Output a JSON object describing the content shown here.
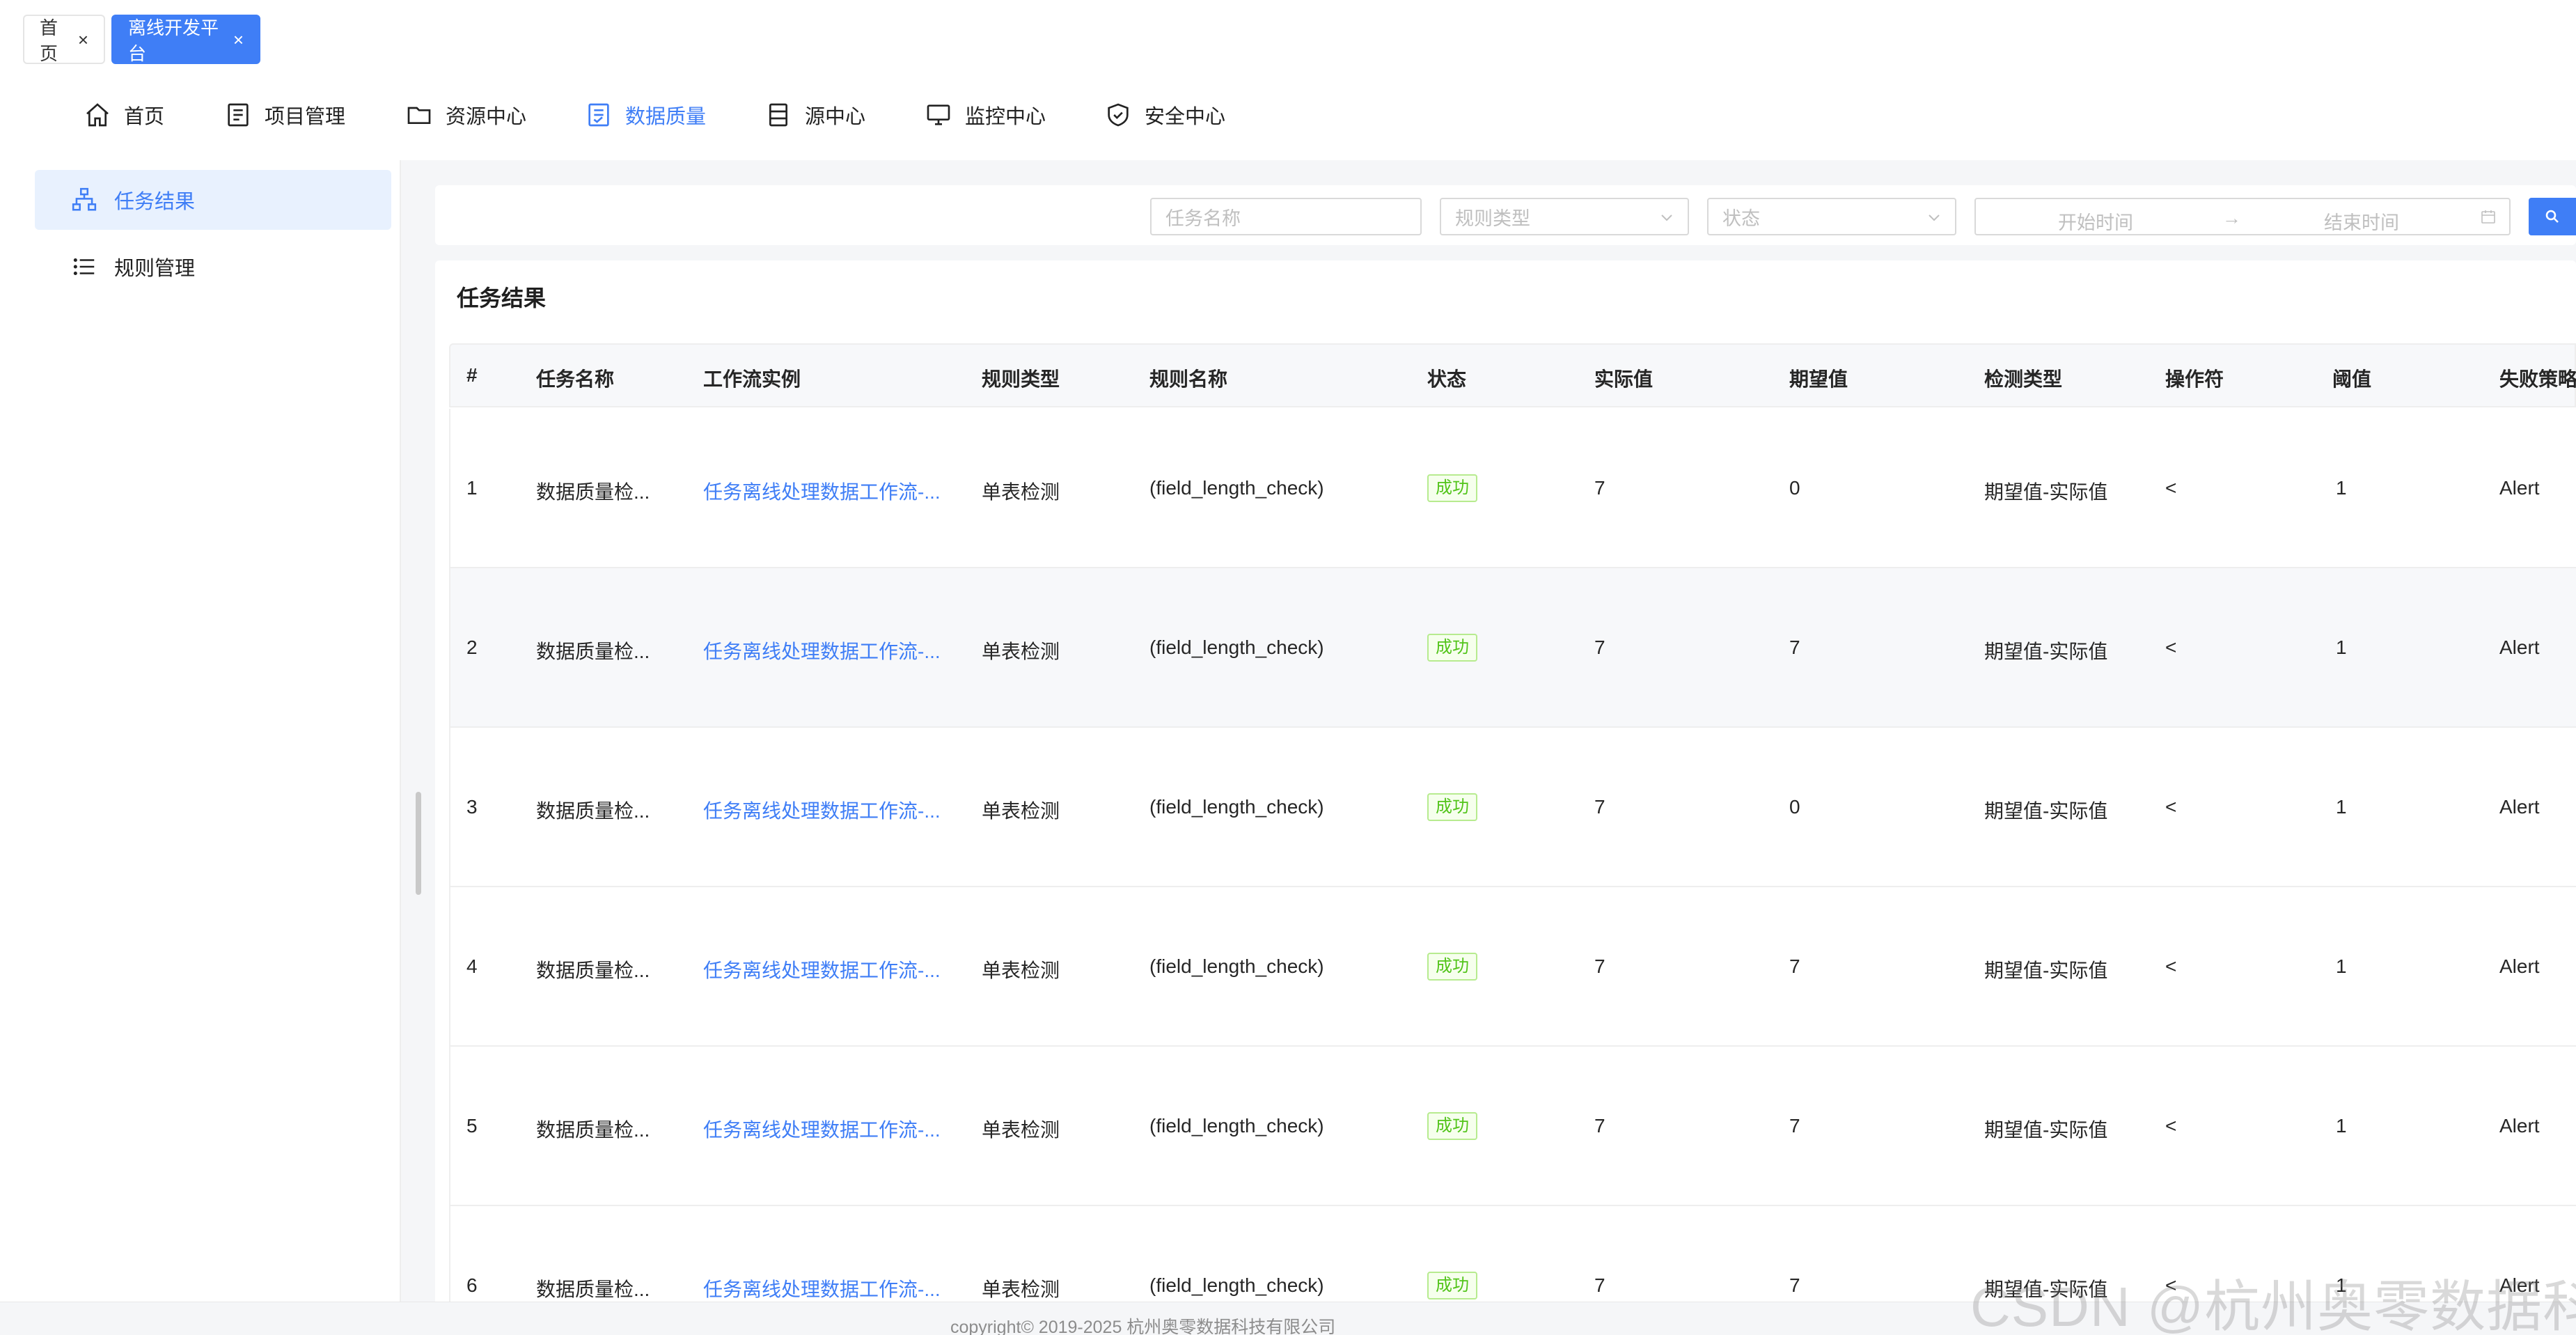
{
  "tabs": [
    {
      "label": "首页"
    },
    {
      "label": "离线开发平台"
    }
  ],
  "topnav": [
    {
      "label": "首页",
      "icon": "home-icon"
    },
    {
      "label": "项目管理",
      "icon": "project-icon"
    },
    {
      "label": "资源中心",
      "icon": "folder-icon"
    },
    {
      "label": "数据质量",
      "icon": "data-quality-icon",
      "active": true
    },
    {
      "label": "源中心",
      "icon": "datasource-icon"
    },
    {
      "label": "监控中心",
      "icon": "monitor-icon"
    },
    {
      "label": "安全中心",
      "icon": "shield-icon"
    }
  ],
  "sidebar": [
    {
      "label": "任务结果",
      "icon": "org-chart-icon",
      "active": true
    },
    {
      "label": "规则管理",
      "icon": "list-icon"
    }
  ],
  "filters": {
    "task_name_placeholder": "任务名称",
    "rule_type_placeholder": "规则类型",
    "status_placeholder": "状态",
    "start_time_placeholder": "开始时间",
    "end_time_placeholder": "结束时间",
    "range_separator": "→"
  },
  "card": {
    "title": "任务结果"
  },
  "table": {
    "columns": [
      "#",
      "任务名称",
      "工作流实例",
      "规则类型",
      "规则名称",
      "状态",
      "实际值",
      "期望值",
      "检测类型",
      "操作符",
      "阈值",
      "失败策略"
    ],
    "rows": [
      {
        "no": "1",
        "task_name": "数据质量检...",
        "workflow": "任务离线处理数据工作流-...",
        "rule_type": "单表检测",
        "rule_name": "(field_length_check)",
        "status": "成功",
        "actual": "7",
        "expected": "0",
        "check_type": "期望值-实际值",
        "operator": "<",
        "threshold": "1",
        "fail_strategy": "Alert"
      },
      {
        "no": "2",
        "task_name": "数据质量检...",
        "workflow": "任务离线处理数据工作流-...",
        "rule_type": "单表检测",
        "rule_name": "(field_length_check)",
        "status": "成功",
        "actual": "7",
        "expected": "7",
        "check_type": "期望值-实际值",
        "operator": "<",
        "threshold": "1",
        "fail_strategy": "Alert"
      },
      {
        "no": "3",
        "task_name": "数据质量检...",
        "workflow": "任务离线处理数据工作流-...",
        "rule_type": "单表检测",
        "rule_name": "(field_length_check)",
        "status": "成功",
        "actual": "7",
        "expected": "0",
        "check_type": "期望值-实际值",
        "operator": "<",
        "threshold": "1",
        "fail_strategy": "Alert"
      },
      {
        "no": "4",
        "task_name": "数据质量检...",
        "workflow": "任务离线处理数据工作流-...",
        "rule_type": "单表检测",
        "rule_name": "(field_length_check)",
        "status": "成功",
        "actual": "7",
        "expected": "7",
        "check_type": "期望值-实际值",
        "operator": "<",
        "threshold": "1",
        "fail_strategy": "Alert"
      },
      {
        "no": "5",
        "task_name": "数据质量检...",
        "workflow": "任务离线处理数据工作流-...",
        "rule_type": "单表检测",
        "rule_name": "(field_length_check)",
        "status": "成功",
        "actual": "7",
        "expected": "7",
        "check_type": "期望值-实际值",
        "operator": "<",
        "threshold": "1",
        "fail_strategy": "Alert"
      },
      {
        "no": "6",
        "task_name": "数据质量检...",
        "workflow": "任务离线处理数据工作流-...",
        "rule_type": "单表检测",
        "rule_name": "(field_length_check)",
        "status": "成功",
        "actual": "7",
        "expected": "7",
        "check_type": "期望值-实际值",
        "operator": "<",
        "threshold": "1",
        "fail_strategy": "Alert"
      }
    ]
  },
  "footer": {
    "copyright": "copyright© 2019-2025 杭州奥零数据科技有限公司"
  },
  "watermark": "CSDN @杭州奥零数据科技",
  "colors": {
    "accent": "#3f7ef6",
    "success": "#52c41a",
    "success_bg": "#f6ffed"
  }
}
